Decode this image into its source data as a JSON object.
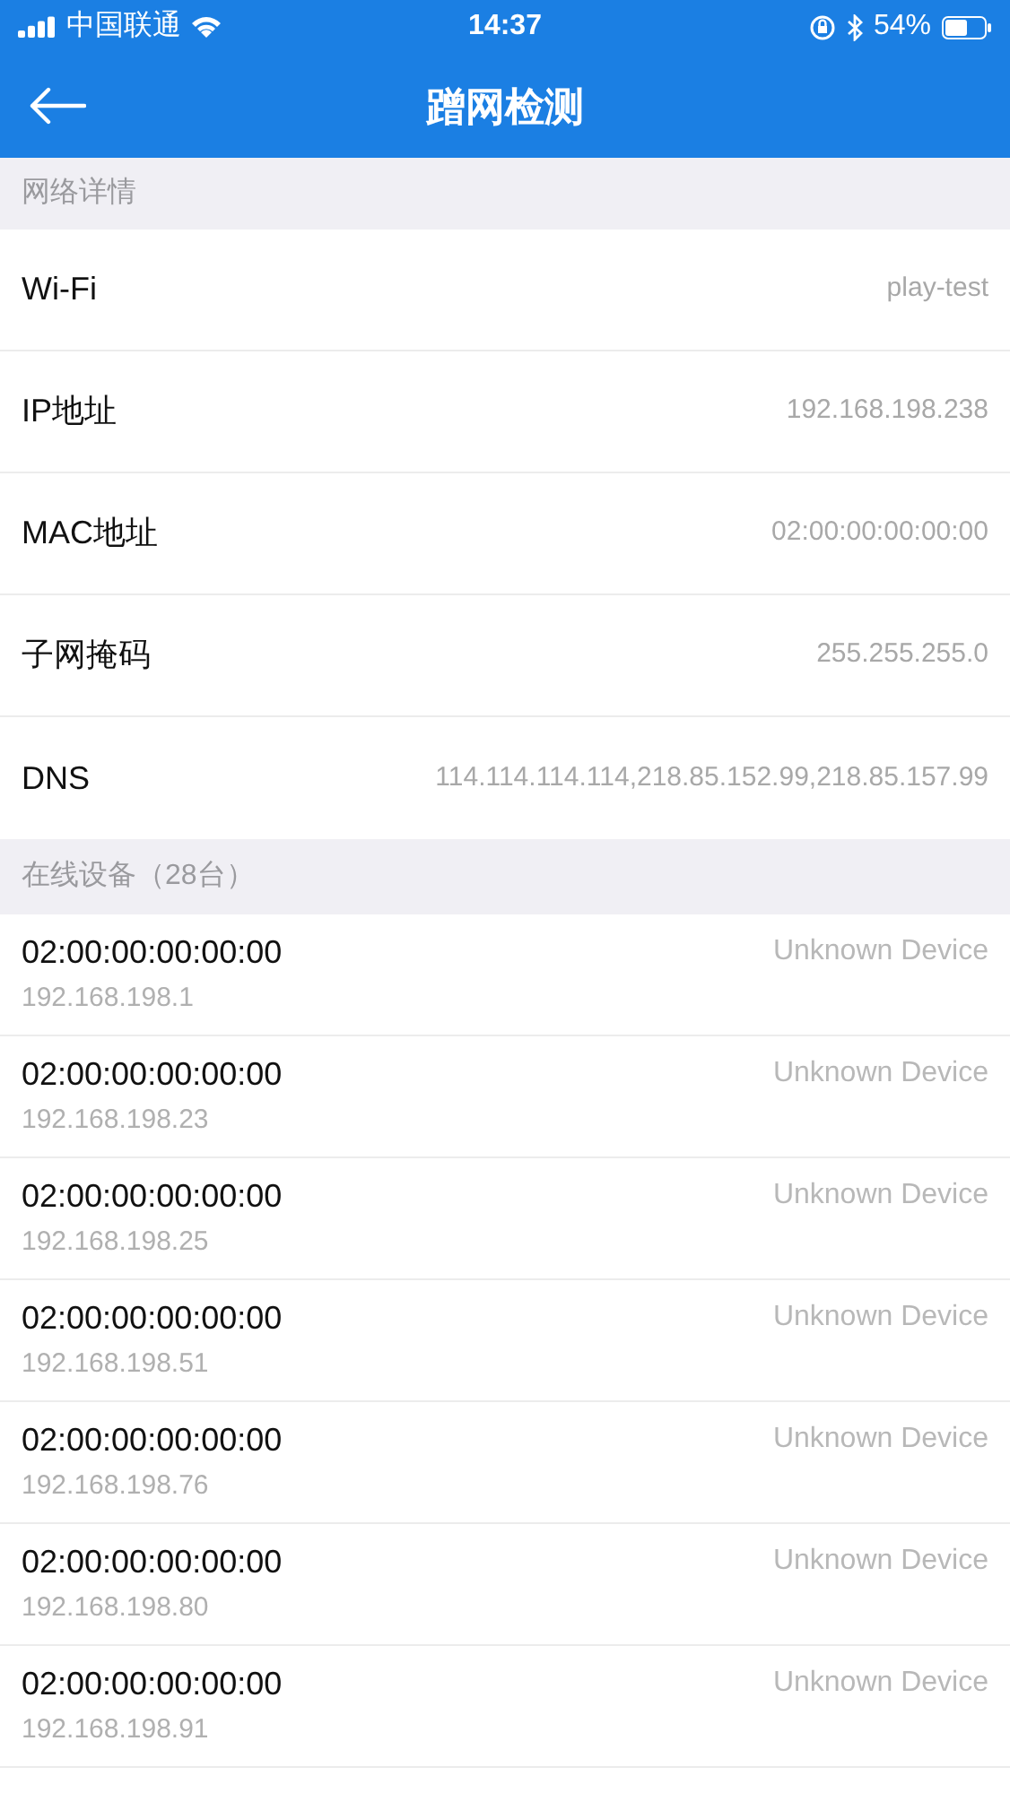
{
  "status_bar": {
    "carrier": "中国联通",
    "time": "14:37",
    "battery": "54%"
  },
  "header": {
    "title": "蹭网检测"
  },
  "network_section": {
    "title": "网络详情",
    "rows": [
      {
        "label": "Wi-Fi",
        "value": "play-test"
      },
      {
        "label": "IP地址",
        "value": "192.168.198.238"
      },
      {
        "label": "MAC地址",
        "value": "02:00:00:00:00:00"
      },
      {
        "label": "子网掩码",
        "value": "255.255.255.0"
      },
      {
        "label": "DNS",
        "value": "114.114.114.114,218.85.152.99,218.85.157.99"
      }
    ]
  },
  "devices_section": {
    "title": "在线设备（28台）",
    "devices": [
      {
        "mac": "02:00:00:00:00:00",
        "ip": "192.168.198.1",
        "name": "Unknown Device"
      },
      {
        "mac": "02:00:00:00:00:00",
        "ip": "192.168.198.23",
        "name": "Unknown Device"
      },
      {
        "mac": "02:00:00:00:00:00",
        "ip": "192.168.198.25",
        "name": "Unknown Device"
      },
      {
        "mac": "02:00:00:00:00:00",
        "ip": "192.168.198.51",
        "name": "Unknown Device"
      },
      {
        "mac": "02:00:00:00:00:00",
        "ip": "192.168.198.76",
        "name": "Unknown Device"
      },
      {
        "mac": "02:00:00:00:00:00",
        "ip": "192.168.198.80",
        "name": "Unknown Device"
      },
      {
        "mac": "02:00:00:00:00:00",
        "ip": "192.168.198.91",
        "name": "Unknown Device"
      }
    ]
  }
}
